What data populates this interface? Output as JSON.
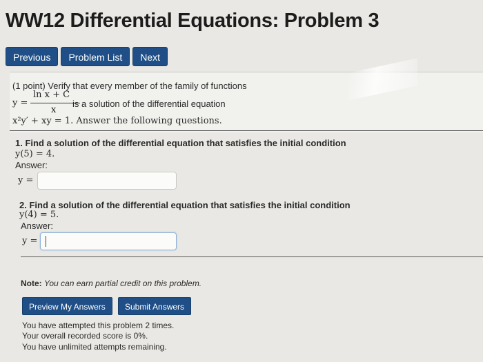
{
  "page": {
    "title": "WW12 Differential Equations: Problem 3"
  },
  "nav": {
    "previous": "Previous",
    "problem_list": "Problem List",
    "next": "Next"
  },
  "problem": {
    "line1": "(1 point) Verify that every member of the family of functions",
    "fraction_numerator": "ln x + C",
    "fraction_denominator": "x",
    "lhs": "y =",
    "line2_rest": "is a solution of the differential equation",
    "equation": "x²y′ + xy = 1. Answer the following questions."
  },
  "part1": {
    "prompt": "1. Find a solution of the differential equation that satisfies the initial condition",
    "condition": "y(5) = 4.",
    "answer_label": "Answer:",
    "input_label": "y =",
    "input_value": ""
  },
  "part2": {
    "prompt": "2. Find a solution of the differential equation that satisfies the initial condition",
    "condition": "y(4) = 5.",
    "answer_label": "Answer:",
    "input_label": "y =",
    "input_value": ""
  },
  "note": {
    "label": "Note:",
    "text": "You can earn partial credit on this problem."
  },
  "buttons": {
    "preview": "Preview My Answers",
    "submit": "Submit Answers"
  },
  "status": {
    "attempts": "You have attempted this problem 2 times.",
    "score": "Your overall recorded score is 0%.",
    "remaining": "You have unlimited attempts remaining."
  }
}
